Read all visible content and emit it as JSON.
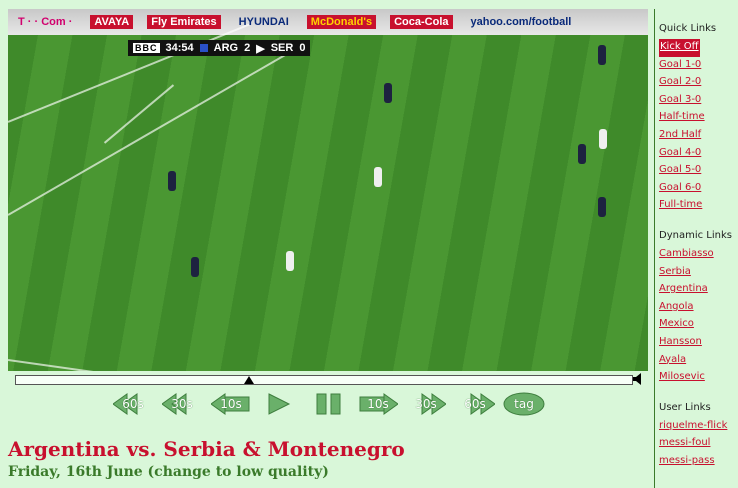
{
  "video": {
    "ads": [
      {
        "text": "T · · Com ·",
        "style": "magenta"
      },
      {
        "text": "AVAYA",
        "style": "red"
      },
      {
        "text": "Fly Emirates",
        "style": "red"
      },
      {
        "text": "HYUNDAI",
        "style": "blue"
      },
      {
        "text": "McDonald's",
        "style": "mcd"
      },
      {
        "text": "Coca-Cola",
        "style": "red"
      },
      {
        "text": "yahoo.com/football",
        "style": "blue"
      }
    ],
    "scoreboard": {
      "broadcaster": "BBC",
      "clock": "34:54",
      "team1": "ARG",
      "score1": "2",
      "team2": "SER",
      "score2": "0"
    },
    "playback_progress": 0.38
  },
  "controls": {
    "back60": "60s",
    "back30": "30s",
    "back10": "10s",
    "fwd10": "10s",
    "fwd30": "30s",
    "fwd60": "60s",
    "tag": "tag"
  },
  "title": "Argentina vs. Serbia & Montenegro",
  "subtitle": "Friday, 16th June (change to low quality)",
  "sidebar": {
    "quick_title": "Quick Links",
    "quick_links": [
      {
        "label": "Kick Off",
        "active": true
      },
      {
        "label": "Goal 1-0"
      },
      {
        "label": "Goal 2-0"
      },
      {
        "label": "Goal 3-0"
      },
      {
        "label": "Half-time"
      },
      {
        "label": "2nd Half"
      },
      {
        "label": "Goal 4-0"
      },
      {
        "label": "Goal 5-0"
      },
      {
        "label": "Goal 6-0"
      },
      {
        "label": "Full-time"
      }
    ],
    "dynamic_title": "Dynamic Links",
    "dynamic_links": [
      {
        "label": "Cambiasso"
      },
      {
        "label": "Serbia"
      },
      {
        "label": "Argentina"
      },
      {
        "label": "Angola"
      },
      {
        "label": "Mexico"
      },
      {
        "label": "Hansson"
      },
      {
        "label": "Ayala"
      },
      {
        "label": "Milosevic"
      }
    ],
    "user_title": "User Links",
    "user_links": [
      {
        "label": "riquelme-flick"
      },
      {
        "label": "messi-foul"
      },
      {
        "label": "messi-pass"
      }
    ]
  },
  "colors": {
    "accent": "#c8102e",
    "background": "#d9f7d9",
    "button_green": "#6ab06a"
  }
}
